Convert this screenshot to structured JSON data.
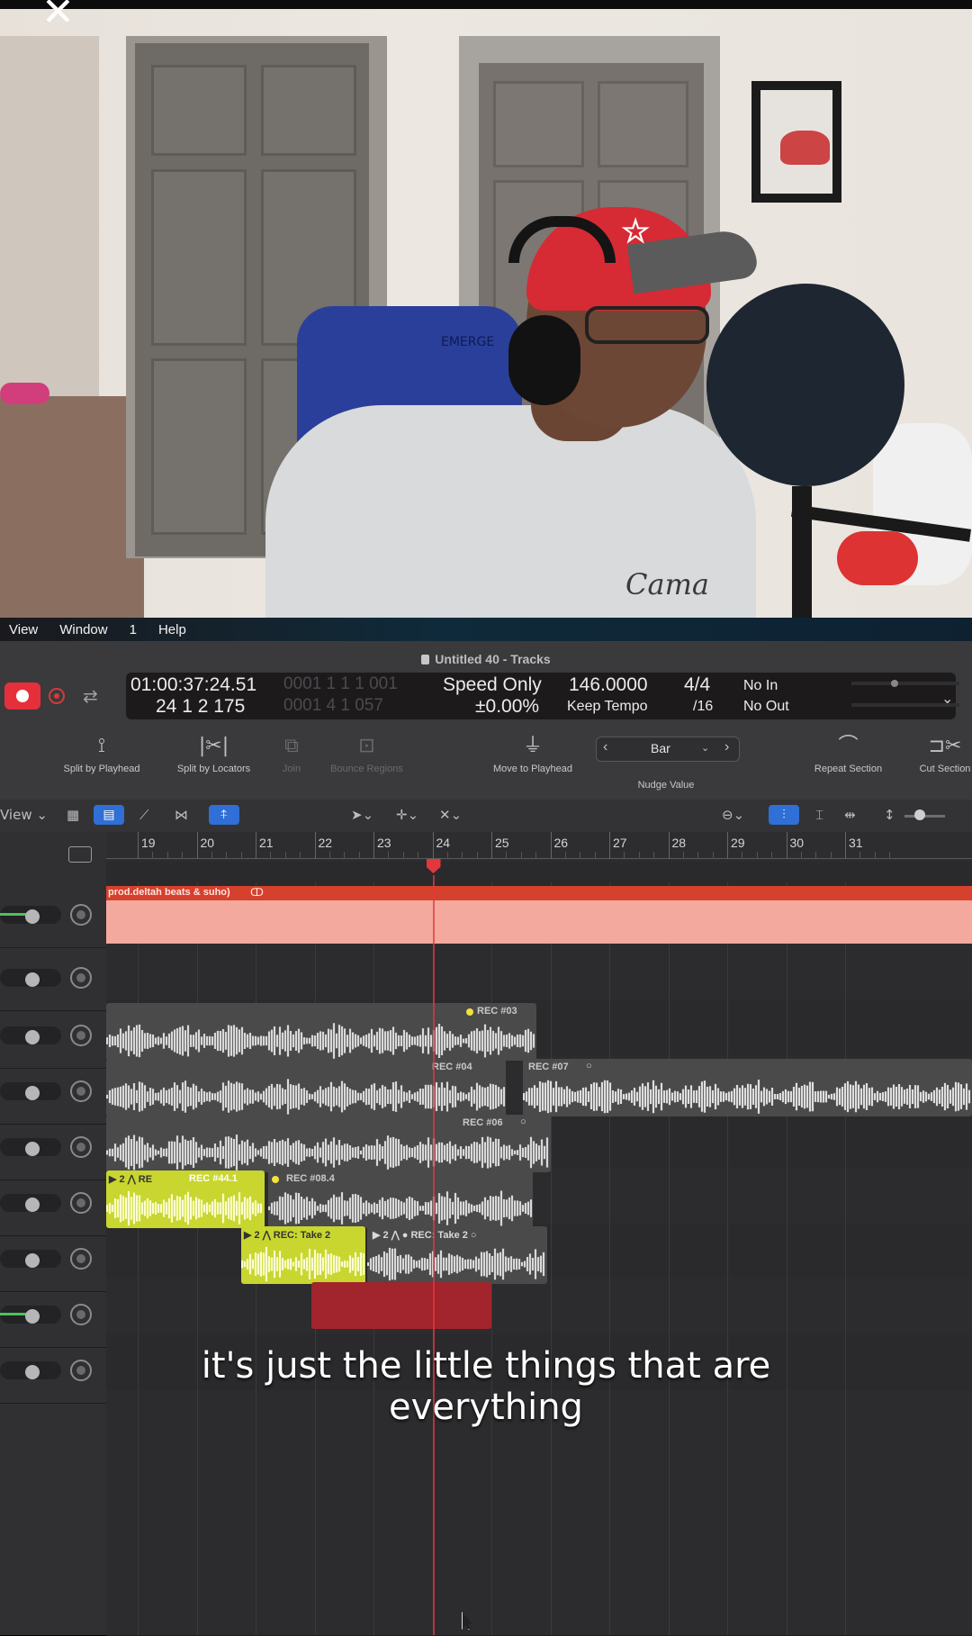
{
  "menubar": {
    "items": [
      "View",
      "Window",
      "1",
      "Help"
    ]
  },
  "window": {
    "title": "Untitled 40 - Tracks"
  },
  "lcd": {
    "smpte": "01:00:37:24.51",
    "smpte_dim": "0001 1 1 1 001",
    "bars": "24 1 2 175",
    "bars_dim": "0001 4 1 057",
    "speed": "Speed Only",
    "speed_pct": "±0.00%",
    "tempo": "146.0000",
    "tempo_mode": "Keep Tempo",
    "sig": "4/4",
    "div": "/16",
    "in": "No In",
    "out": "No Out"
  },
  "toolbar": {
    "split_playhead": "Split by Playhead",
    "split_locators": "Split by Locators",
    "join": "Join",
    "bounce": "Bounce Regions",
    "move_playhead": "Move to Playhead",
    "nudge_value": "Bar",
    "nudge_label": "Nudge Value",
    "repeat": "Repeat Section",
    "cut": "Cut Section"
  },
  "trackbar": {
    "view": "View"
  },
  "ruler": {
    "bars": [
      "19",
      "20",
      "21",
      "22",
      "23",
      "24",
      "25",
      "26",
      "27",
      "28",
      "29",
      "30",
      "31"
    ]
  },
  "playhead_bar": 24,
  "regions": {
    "beat": "prod.deltah beats & suho)",
    "rec03": "REC #03",
    "rec04": "REC #04",
    "rec07": "REC #07",
    "rec06": "REC #06",
    "yel1": "2",
    "yel2": "REC #44.1",
    "rec08": "REC #08.4",
    "take_a": "REC: Take 2",
    "take_b": "REC: Take 2",
    "take_num": "2"
  },
  "subtitle": {
    "line1": "it's just the little things that are",
    "line2": "everything"
  },
  "colors": {
    "record": "#e5303b",
    "beat_region": "#f4a99f",
    "beat_header": "#d5412c",
    "yellow_region": "#c8d62f",
    "red_region": "#a2242d",
    "selected_tool": "#2f6fd6"
  }
}
